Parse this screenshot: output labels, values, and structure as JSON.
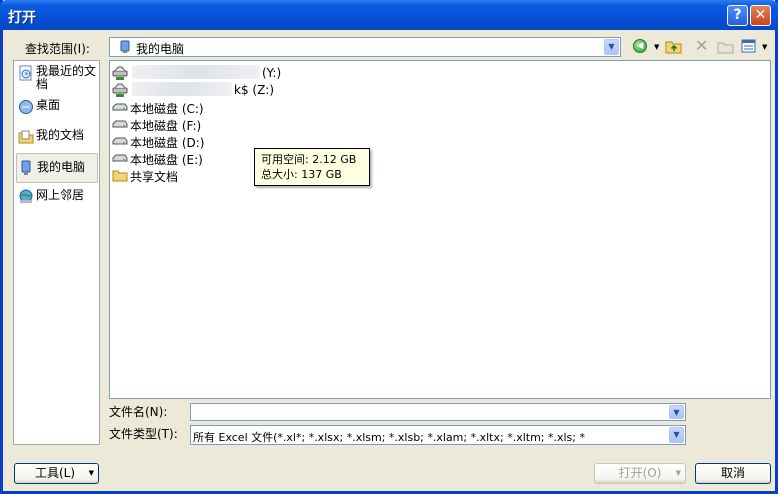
{
  "window": {
    "title": "打开"
  },
  "lookin": {
    "label": "查找范围(I):",
    "value": "我的电脑"
  },
  "places": [
    {
      "label": "我最近的文档",
      "icon": "recent-docs-icon"
    },
    {
      "label": "桌面",
      "icon": "desktop-icon"
    },
    {
      "label": "我的文档",
      "icon": "my-documents-icon"
    },
    {
      "label": "我的电脑",
      "icon": "my-computer-icon",
      "selected": true
    },
    {
      "label": "网上邻居",
      "icon": "network-icon"
    }
  ],
  "files": [
    {
      "label": "(Y:)",
      "icon": "network-drive-icon",
      "blurred": true
    },
    {
      "label": "k$ (Z:)",
      "icon": "network-drive-icon",
      "blurred": true
    },
    {
      "label": "本地磁盘 (C:)",
      "icon": "local-disk-icon"
    },
    {
      "label": "本地磁盘 (F:)",
      "icon": "local-disk-icon"
    },
    {
      "label": "本地磁盘 (D:)",
      "icon": "local-disk-icon"
    },
    {
      "label": "本地磁盘 (E:)",
      "icon": "local-disk-icon"
    },
    {
      "label": "共享文档",
      "icon": "folder-icon"
    }
  ],
  "tooltip": {
    "line1": "可用空间: 2.12 GB",
    "line2": "总大小: 137 GB"
  },
  "filename": {
    "label": "文件名(N):",
    "value": ""
  },
  "filetype": {
    "label": "文件类型(T):",
    "value": "所有 Excel 文件(*.xl*; *.xlsx; *.xlsm; *.xlsb; *.xlam; *.xltx; *.xltm; *.xls; *"
  },
  "buttons": {
    "tools": "工具(L)",
    "open": "打开(O)",
    "cancel": "取消",
    "help": "?",
    "close": "✕"
  }
}
